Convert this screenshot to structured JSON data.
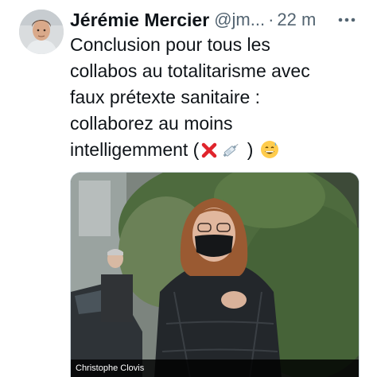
{
  "author": {
    "name": "Jérémie Mercier",
    "handle": "@jm...",
    "separator": "·",
    "time": "22 m",
    "avatar_icon": "person-avatar"
  },
  "tweet": {
    "lines": [
      "Conclusion pour tous les",
      "collabos au totalitarisme avec",
      "faux prétexte sanitaire :",
      "collaborez au moins"
    ],
    "last_line_prefix": "intelligemment (",
    "last_line_middle": ")",
    "emojis": [
      "cross-mark-icon",
      "syringe-icon",
      "grinning-sweat-icon"
    ]
  },
  "media": {
    "credit": "Christophe Clovis",
    "description_icon": "photo-image"
  },
  "actions": {
    "more_icon": "more-horizontal-icon"
  },
  "colors": {
    "text": "#0f1419",
    "secondary": "#536471",
    "cross": "#e0242c"
  }
}
